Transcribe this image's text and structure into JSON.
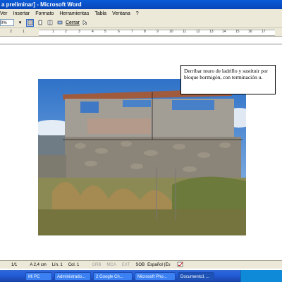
{
  "window": {
    "title": "a preliminar] - Microsoft Word"
  },
  "menu": {
    "items": [
      "Ver",
      "Insertar",
      "Formato",
      "Herramientas",
      "Tabla",
      "Ventana",
      "?"
    ]
  },
  "toolbar": {
    "zoom": "0%",
    "close_label": "Cerrar"
  },
  "ruler": {
    "numbers": [
      "1",
      "2",
      "1",
      "2",
      "3",
      "4",
      "5",
      "6",
      "7",
      "8",
      "9",
      "10",
      "11",
      "12",
      "13",
      "14",
      "15",
      "16",
      "17"
    ]
  },
  "callout": {
    "text": "Derribar muro de ladrillo y sustituir por bloque hormigón, con terminación u."
  },
  "status": {
    "page": "1/1",
    "position": "A 2,4 cm",
    "line": "Lín. 1",
    "col": "Col. 1",
    "grb": "GRB",
    "mca": "MCA",
    "ext": "EXT",
    "sob": "SOB",
    "language": "Español (Es"
  },
  "taskbar": {
    "items": [
      "Mi PC",
      "Administrado...",
      "2 Google Ch...",
      "Microsoft Pho...",
      "Documento1 ...",
      ""
    ]
  },
  "colors": {
    "title_bar": "#0a5bd8",
    "chrome": "#ece9d8",
    "taskbar": "#245edb"
  }
}
